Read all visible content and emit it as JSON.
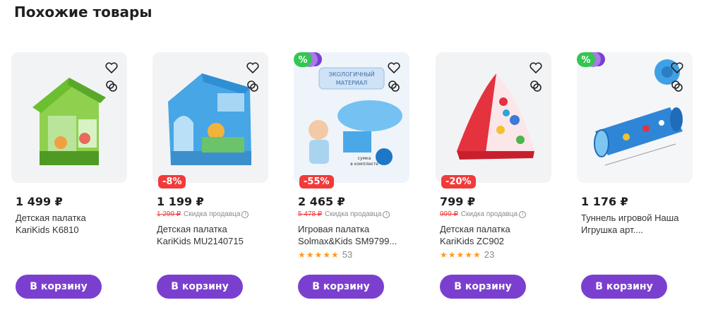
{
  "section_title": "Похожие товары",
  "colors": {
    "accent": "#7b3fd0",
    "discount": "#f23a3a",
    "promo": "#33c652",
    "star": "#ff9a1f"
  },
  "cart_label": "В корзину",
  "products": [
    {
      "price": "1 499 ₽",
      "name_line1": "Детская палатка",
      "name_line2": "KariKids K6810"
    },
    {
      "discount": "-8%",
      "price": "1 199 ₽",
      "old_price": "1 299 ₽",
      "seller_note": "Скидка продавца",
      "name_line1": "Детская палатка",
      "name_line2": "KariKids MU2140715"
    },
    {
      "promo_label": "%",
      "discount": "-55%",
      "price": "2 465 ₽",
      "old_price": "5 478 ₽",
      "seller_note": "Скидка продавца",
      "name_line1": "Игровая палатка",
      "name_line2": "Solmax&Kids SM9799...",
      "rating_count": "53",
      "image_text_top": "ЭКОЛОГИЧНЫЙ",
      "image_text_bottom": "МАТЕРИАЛ",
      "image_caption1": "сумка",
      "image_caption2": "в комплекте"
    },
    {
      "discount": "-20%",
      "price": "799 ₽",
      "old_price": "999 ₽",
      "seller_note": "Скидка продавца",
      "name_line1": "Детская палатка",
      "name_line2": "KariKids ZC902",
      "rating_count": "23"
    },
    {
      "promo_label": "%",
      "price": "1 176 ₽",
      "name_line1": "Туннель игровой Наша",
      "name_line2": "Игрушка арт...."
    }
  ]
}
